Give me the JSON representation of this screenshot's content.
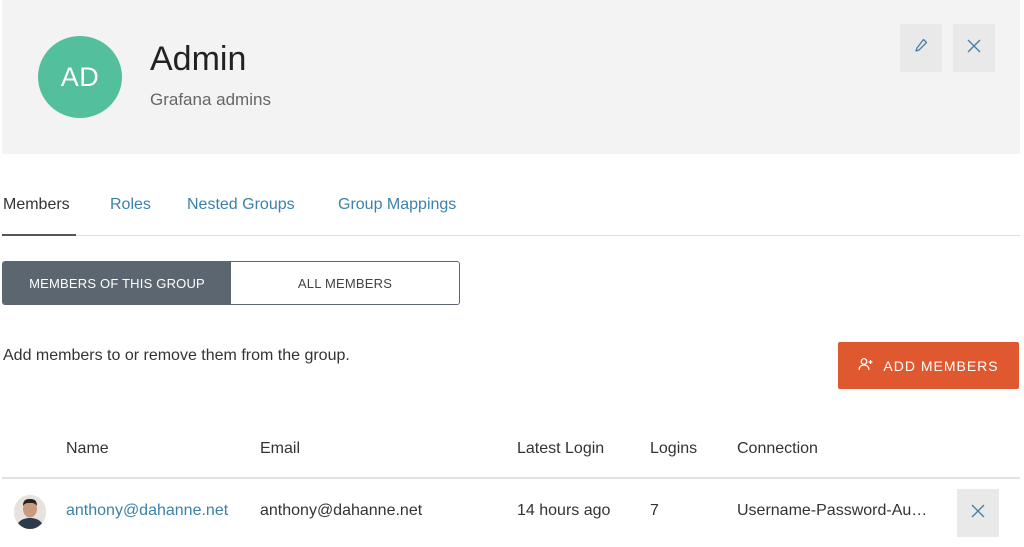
{
  "group": {
    "avatar_initials": "AD",
    "name": "Admin",
    "description": "Grafana admins"
  },
  "header_actions": {
    "edit_icon": "pencil-icon",
    "close_icon": "close-icon"
  },
  "tabs": [
    {
      "label": "Members",
      "active": true
    },
    {
      "label": "Roles",
      "active": false
    },
    {
      "label": "Nested Groups",
      "active": false
    },
    {
      "label": "Group Mappings",
      "active": false
    }
  ],
  "member_filter": {
    "options": [
      "MEMBERS OF THIS GROUP",
      "ALL MEMBERS"
    ],
    "selected": "MEMBERS OF THIS GROUP"
  },
  "description_text": "Add members to or remove them from the group.",
  "add_button": {
    "label": "ADD MEMBERS",
    "icon": "add-user-icon",
    "color": "#e0582f"
  },
  "table": {
    "columns": [
      "Name",
      "Email",
      "Latest Login",
      "Logins",
      "Connection"
    ],
    "rows": [
      {
        "name": "anthony@dahanne.net",
        "email": "anthony@dahanne.net",
        "latest_login": "14 hours ago",
        "logins": "7",
        "connection": "Username-Password-Au…"
      }
    ]
  },
  "colors": {
    "accent_link": "#3b82a8",
    "avatar_bg": "#53bf9c",
    "segment_active": "#5c6670"
  }
}
